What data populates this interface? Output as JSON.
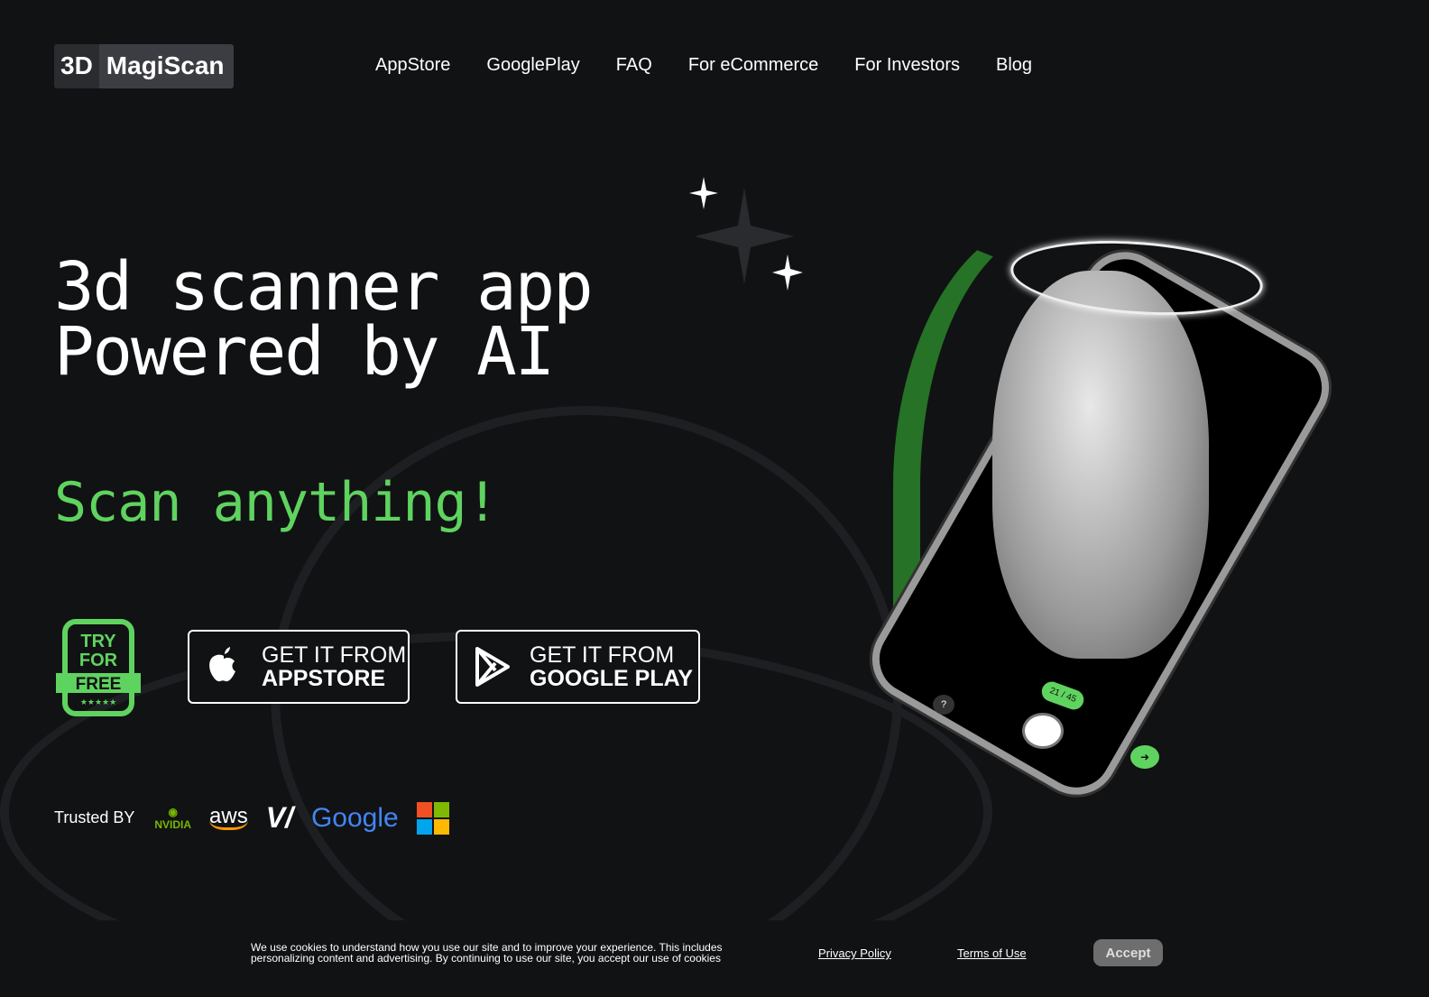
{
  "logo": {
    "part1": "3D",
    "part2": "MagiScan"
  },
  "nav": [
    "AppStore",
    "GooglePlay",
    "FAQ",
    "For eCommerce",
    "For Investors",
    "Blog"
  ],
  "hero": {
    "line1": "3d scanner app",
    "line2": "Powered by AI",
    "tagline": "Scan anything!"
  },
  "badge": {
    "line1": "TRY",
    "line2": "FOR",
    "line3": "FREE",
    "stars": "★★★★★"
  },
  "buttons": {
    "appstore": {
      "top": "GET IT FROM",
      "bottom": "APPSTORE"
    },
    "googleplay": {
      "top": "GET IT FROM",
      "bottom": "GOOGLE PLAY"
    }
  },
  "trusted": {
    "label": "Trusted BY",
    "logos": [
      "NVIDIA",
      "aws",
      "Vultr",
      "Google",
      "Microsoft"
    ]
  },
  "phone": {
    "counter": "21 / 45",
    "help": "?"
  },
  "cookie": {
    "text": "We use cookies to understand how you use our site and to improve your experience. This includes personalizing content and advertising. By continuing to use our site, you accept our use of cookies",
    "privacy": "Privacy Policy",
    "terms": "Terms of Use",
    "accept": "Accept"
  },
  "colors": {
    "background": "#111214",
    "accent": "#5fd35f"
  }
}
